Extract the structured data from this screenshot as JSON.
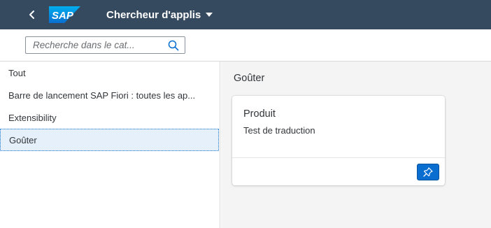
{
  "header": {
    "app_title": "Chercheur d'applis",
    "logo_text": "SAP",
    "icons": {
      "back": "back-chevron-icon",
      "caret": "caret-down-icon"
    },
    "colors": {
      "shell_bg": "#354a5f",
      "logo_blue": "#0a6ed1"
    }
  },
  "search": {
    "placeholder": "Recherche dans le cat...",
    "value": "",
    "icon": "search-icon"
  },
  "sidebar": {
    "items": [
      {
        "label": "Tout",
        "selected": false
      },
      {
        "label": "Barre de lancement SAP Fiori : toutes les ap...",
        "selected": false
      },
      {
        "label": "Extensibility",
        "selected": false
      },
      {
        "label": "Goûter",
        "selected": true
      }
    ]
  },
  "main": {
    "section_title": "Goûter",
    "tile": {
      "title": "Produit",
      "subtitle": "Test de traduction",
      "pin_icon": "pin-icon",
      "pin_color": "#0a6ed1"
    }
  }
}
